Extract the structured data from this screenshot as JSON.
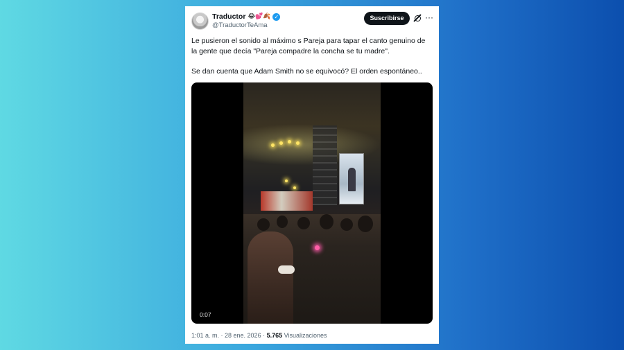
{
  "tweet": {
    "author_name": "Traductor",
    "author_emojis": "😂💕🍂",
    "handle": "@TraductorTeAma",
    "subscribe_label": "Suscribirse",
    "more_label": "···",
    "text_line1": "Le pusieron el sonido al máximo s Pareja para tapar el canto genuino de la gente que decía \"Pareja compadre la concha se tu madre\".",
    "text_line2": "Se dan cuenta que Adam Smith no se equivocó? El orden espontáneo..",
    "video_time": "0:07",
    "timestamp": "1:01 a. m. · 28 ene. 2026 · ",
    "views_count": "5.765",
    "views_label": " Visualizaciones"
  },
  "colors": {
    "background_left": "#5fd9e3",
    "background_right": "#0c4fae",
    "verified": "#1d9bf0"
  }
}
